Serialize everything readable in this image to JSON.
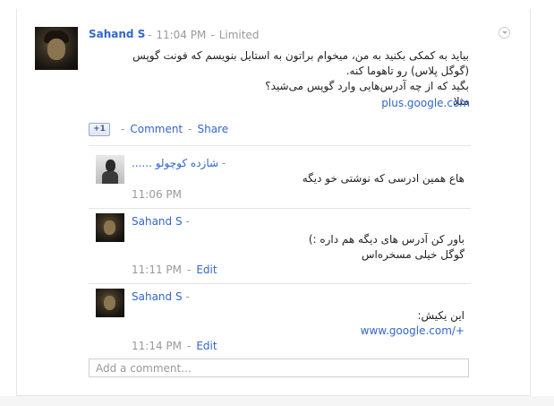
{
  "post": {
    "author": "Sahand S",
    "time": "11:04 PM",
    "visibility": "Limited",
    "body_lines": [
      "بیاید به کمکی بکنید به من، میخوام براتون به استایل بنویسم که فونت گوپس",
      "(گوگل پلاس) رو تاهوما کنه.",
      "بگید که از چه آدرس‌هایی وارد گوپس می‌شید؟",
      "مثلا"
    ],
    "link": "plus.google.com",
    "actions": {
      "plusone_label": "+1",
      "comment_label": "Comment",
      "share_label": "Share"
    }
  },
  "comments": [
    {
      "author": "شازده کوچولو ......",
      "text": "هاع همین ادرسی که نوشتی خو دیگه",
      "time": "11:06 PM"
    },
    {
      "author": "Sahand S",
      "text_lines": [
        "باور کن آدرس های دیگه هم داره :)",
        "گوگل خیلی مسخره‌اس"
      ],
      "time": "11:11 PM",
      "edit_label": "Edit"
    },
    {
      "author": "Sahand S",
      "text": "این یکیش:",
      "link": "www.google.com/+",
      "time": "11:14 PM",
      "edit_label": "Edit"
    }
  ],
  "add_comment_placeholder": "Add a comment...",
  "colors": {
    "link": "#3366cc",
    "meta": "#999999"
  }
}
